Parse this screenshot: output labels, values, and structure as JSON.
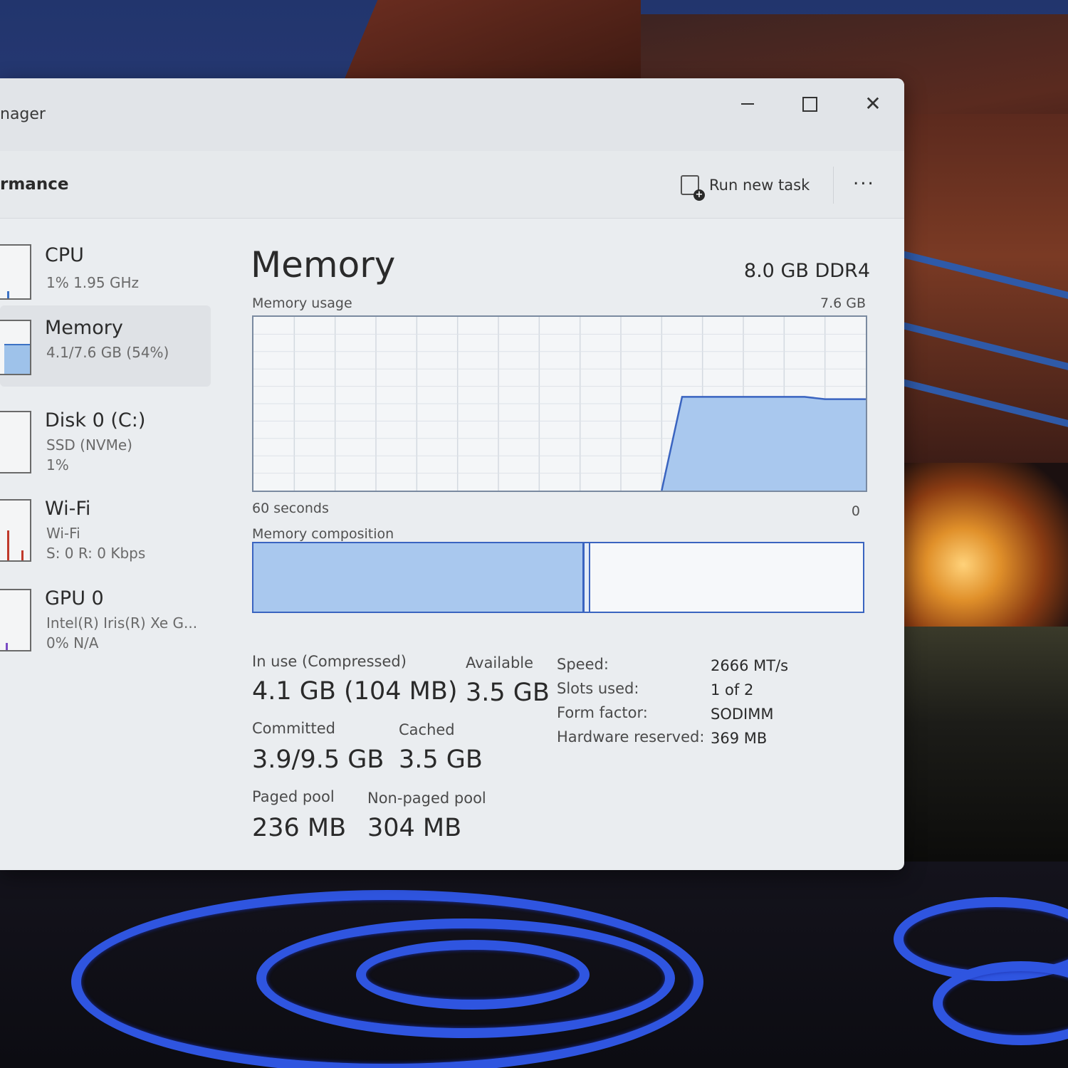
{
  "window": {
    "app_title": "nager",
    "controls": {
      "minimize": "minimize-icon",
      "maximize": "maximize-icon",
      "close": "close-icon"
    }
  },
  "command_bar": {
    "page_title": "rmance",
    "run_new_task": "Run new task",
    "more": "..."
  },
  "sidebar": {
    "items": [
      {
        "name": "CPU",
        "line1": "1%  1.95 GHz",
        "line2": "",
        "usage_fraction": 0.01
      },
      {
        "name": "Memory",
        "line1": "4.1/7.6 GB (54%)",
        "line2": "",
        "usage_fraction": 0.54
      },
      {
        "name": "Disk 0 (C:)",
        "line1": "SSD (NVMe)",
        "line2": "1%",
        "usage_fraction": 0.01
      },
      {
        "name": "Wi-Fi",
        "line1": "Wi-Fi",
        "line2": "S: 0  R: 0 Kbps",
        "usage_fraction": 0.0
      },
      {
        "name": "GPU 0",
        "line1": "Intel(R) Iris(R) Xe G...",
        "line2": "0%  N/A",
        "usage_fraction": 0.0
      }
    ],
    "selected": "Memory"
  },
  "memory": {
    "title": "Memory",
    "spec": "8.0 GB DDR4",
    "usage_label": "Memory usage",
    "usage_max": "7.6 GB",
    "axis_left": "60 seconds",
    "axis_right": "0",
    "composition_label": "Memory composition",
    "composition": {
      "in_use_fraction": 0.54
    },
    "stats": {
      "in_use_label": "In use (Compressed)",
      "in_use_value": "4.1 GB (104 MB)",
      "available_label": "Available",
      "available_value": "3.5 GB",
      "committed_label": "Committed",
      "committed_value": "3.9/9.5 GB",
      "cached_label": "Cached",
      "cached_value": "3.5 GB",
      "paged_label": "Paged pool",
      "paged_value": "236 MB",
      "nonpaged_label": "Non-paged pool",
      "nonpaged_value": "304 MB"
    },
    "details": [
      {
        "key": "Speed:",
        "value": "2666 MT/s"
      },
      {
        "key": "Slots used:",
        "value": "1 of 2"
      },
      {
        "key": "Form factor:",
        "value": "SODIMM"
      },
      {
        "key": "Hardware reserved:",
        "value": "369 MB"
      }
    ]
  },
  "chart_data": {
    "type": "area",
    "title": "Memory usage",
    "xlabel": "60 seconds",
    "ylabel": "",
    "x": [
      60,
      58,
      56,
      54,
      52,
      50,
      48,
      46,
      44,
      42,
      40,
      38,
      36,
      34,
      32,
      30,
      28,
      26,
      24,
      22,
      20,
      18,
      16,
      14,
      12,
      10,
      8,
      6,
      4,
      2,
      0
    ],
    "values": [
      null,
      null,
      null,
      null,
      null,
      null,
      null,
      null,
      null,
      null,
      null,
      null,
      null,
      null,
      null,
      null,
      null,
      null,
      null,
      null,
      0,
      4.1,
      4.1,
      4.1,
      4.1,
      4.1,
      4.1,
      4.1,
      4.0,
      4.0,
      4.0
    ],
    "ylim": [
      0,
      7.6
    ],
    "xlim": [
      60,
      0
    ],
    "grid": true,
    "colors": {
      "fill": "#a9c8ee",
      "line": "#3a64c0"
    }
  }
}
